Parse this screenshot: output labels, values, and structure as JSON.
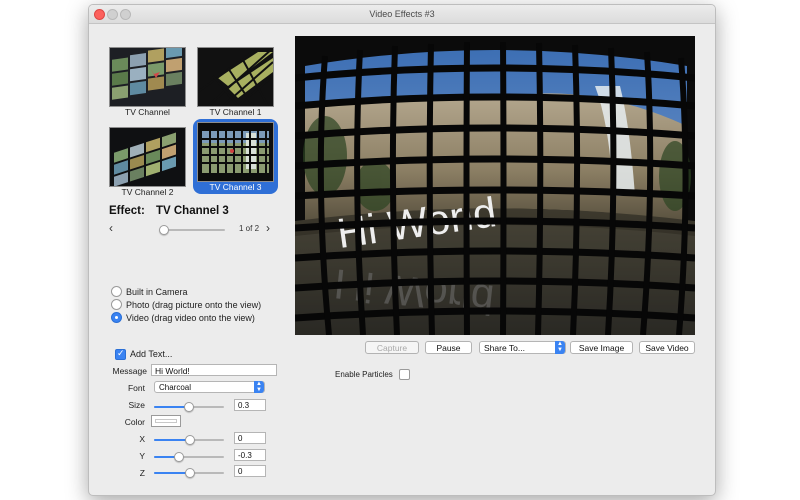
{
  "window": {
    "title": "Video Effects #3"
  },
  "effects": {
    "thumbnails": [
      {
        "label": "TV Channel",
        "selected": false
      },
      {
        "label": "TV Channel 1",
        "selected": false
      },
      {
        "label": "TV Channel 2",
        "selected": false
      },
      {
        "label": "TV Channel 3",
        "selected": true
      }
    ],
    "effect_label": "Effect:",
    "effect_name": "TV Channel 3",
    "page_indicator": "1 of 2",
    "page_slider_fraction": 0.0
  },
  "source": {
    "options": [
      {
        "label": "Built in Camera",
        "selected": false
      },
      {
        "label": "Photo (drag picture onto the view)",
        "selected": false
      },
      {
        "label": "Video (drag video onto the view)",
        "selected": true
      }
    ]
  },
  "text_settings": {
    "add_text_label": "Add Text...",
    "add_text_checked": true,
    "message_label": "Message",
    "message_value": "Hi World!",
    "font_label": "Font",
    "font_value": "Charcoal",
    "size_label": "Size",
    "size_value": "0.3",
    "color_label": "Color",
    "color_value": "#ffffff",
    "x_label": "X",
    "x_value": "0",
    "y_label": "Y",
    "y_value": "-0.3",
    "z_label": "Z",
    "z_value": "0"
  },
  "preview": {
    "overlay_text": "Hi World"
  },
  "toolbar": {
    "capture_label": "Capture",
    "pause_label": "Pause",
    "share_label": "Share To...",
    "save_image_label": "Save Image",
    "save_video_label": "Save Video"
  },
  "particles": {
    "label": "Enable Particles",
    "checked": false
  },
  "colors": {
    "accent": "#3a83f2",
    "selection": "#2f6fd6"
  }
}
